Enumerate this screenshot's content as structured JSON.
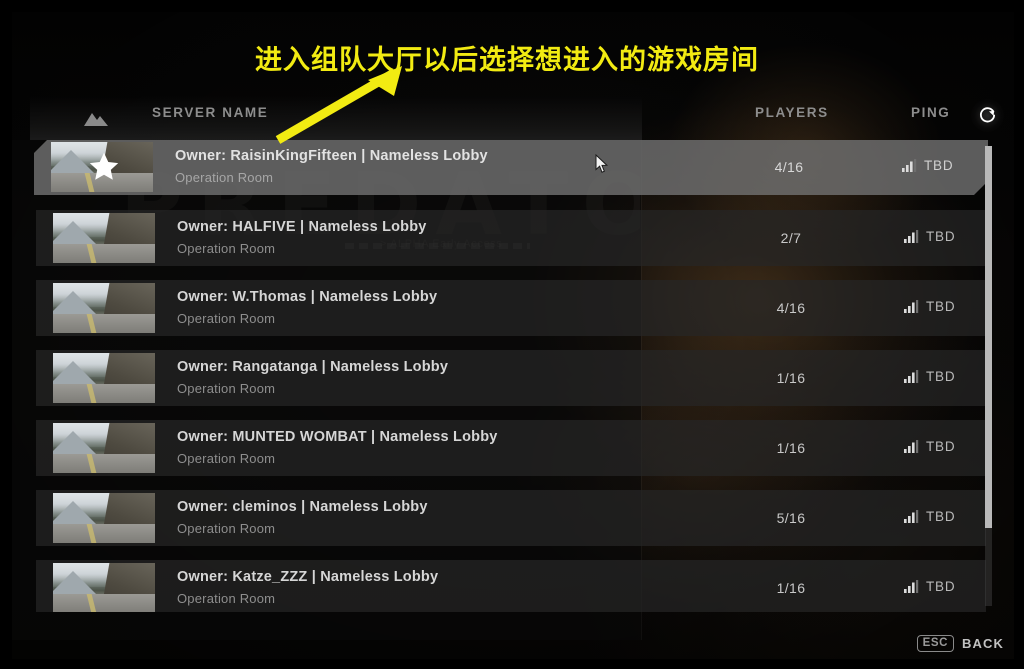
{
  "annotation": {
    "text": "进入组队大厅以后选择想进入的游戏房间",
    "color": "#f2eb12",
    "arrow_icon": "arrow-up-right-icon"
  },
  "background": {
    "logo_text": "PREDATOR",
    "alpha_banner": "> ALPHA Early Access"
  },
  "header": {
    "thumbnail_icon": "mountain-thumbnail-icon",
    "server_name_label": "SERVER NAME",
    "players_label": "PLAYERS",
    "ping_label": "PING",
    "refresh_icon": "refresh-icon"
  },
  "scrollbar": {
    "thumb_icon": "scrollbar-thumb"
  },
  "footer": {
    "esc_key": "ESC",
    "back_label": "BACK"
  },
  "cursor": {
    "icon": "mouse-pointer-icon"
  },
  "server_list": {
    "rows": [
      {
        "title": "Owner: RaisinKingFifteen | Nameless Lobby",
        "subtitle": "Operation Room",
        "players": "4/16",
        "ping": "TBD",
        "favorite": true,
        "selected": true
      },
      {
        "title": "Owner: HALFIVE | Nameless Lobby",
        "subtitle": "Operation Room",
        "players": "2/7",
        "ping": "TBD",
        "favorite": false,
        "selected": false
      },
      {
        "title": "Owner: W.Thomas | Nameless Lobby",
        "subtitle": "Operation Room",
        "players": "4/16",
        "ping": "TBD",
        "favorite": false,
        "selected": false
      },
      {
        "title": "Owner: Rangatanga | Nameless Lobby",
        "subtitle": "Operation Room",
        "players": "1/16",
        "ping": "TBD",
        "favorite": false,
        "selected": false
      },
      {
        "title": "Owner: MUNTED WOMBAT | Nameless Lobby",
        "subtitle": "Operation Room",
        "players": "1/16",
        "ping": "TBD",
        "favorite": false,
        "selected": false
      },
      {
        "title": "Owner: cleminos | Nameless Lobby",
        "subtitle": "Operation Room",
        "players": "5/16",
        "ping": "TBD",
        "favorite": false,
        "selected": false
      },
      {
        "title": "Owner: Katze_ZZZ | Nameless Lobby",
        "subtitle": "Operation Room",
        "players": "1/16",
        "ping": "TBD",
        "favorite": false,
        "selected": false
      }
    ]
  }
}
